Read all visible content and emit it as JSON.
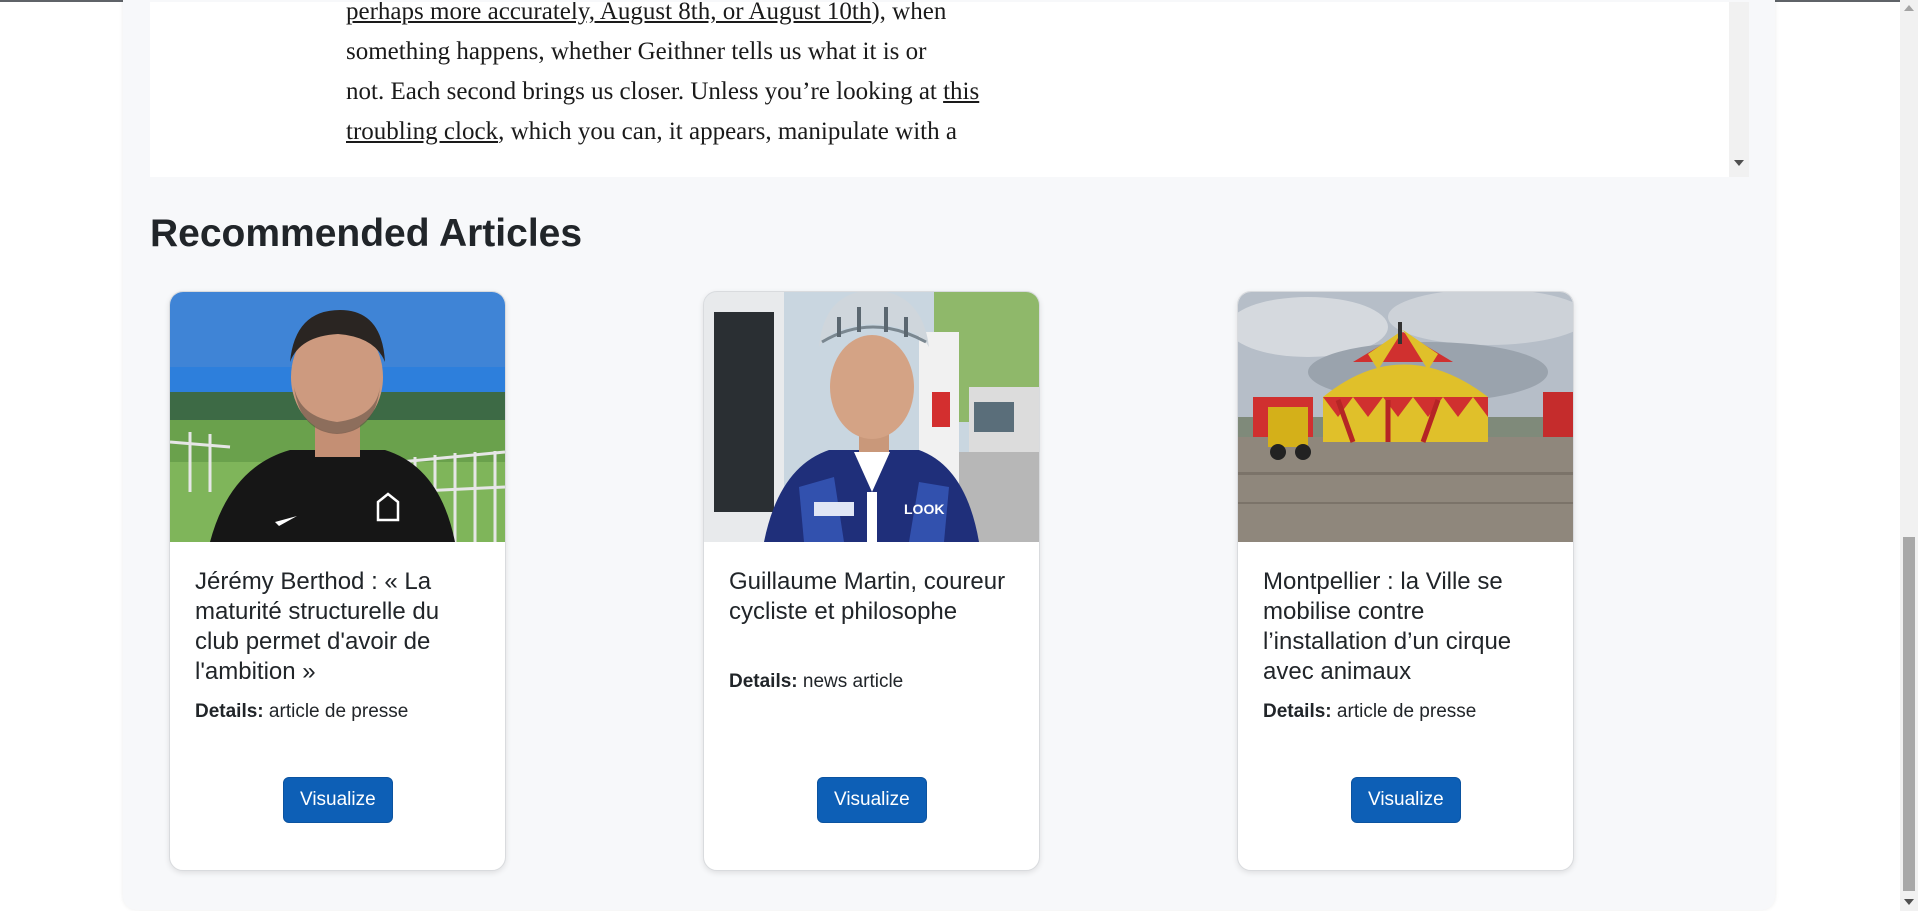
{
  "article": {
    "line1_link": "perhaps more accurately, August 8th, or August 10th",
    "line1_rest": "), when",
    "line2": "something happens, whether Geithner tells us what it is or",
    "line3_before": "not. Each second brings us closer. Unless you’re looking at ",
    "line3_link": "this",
    "line4_link": "troubling clock",
    "line4_rest": ", which you can, it appears, manipulate with a"
  },
  "recommended": {
    "title": "Recommended Articles",
    "details_label": "Details:",
    "cards": [
      {
        "title": "Jérémy Berthod : « La maturité structurelle du club permet d'avoir de l'ambition »",
        "details": "article de presse",
        "button": "Visualize"
      },
      {
        "title": "Guillaume Martin, coureur cycliste et philosophe",
        "details": "news article",
        "button": "Visualize"
      },
      {
        "title": "Montpellier : la Ville se mobilise contre l’installation d’un cirque avec animaux",
        "details": "article de presse",
        "button": "Visualize"
      }
    ]
  },
  "colors": {
    "button": "#0d5fb6",
    "page_bg": "#f7f8fa"
  }
}
